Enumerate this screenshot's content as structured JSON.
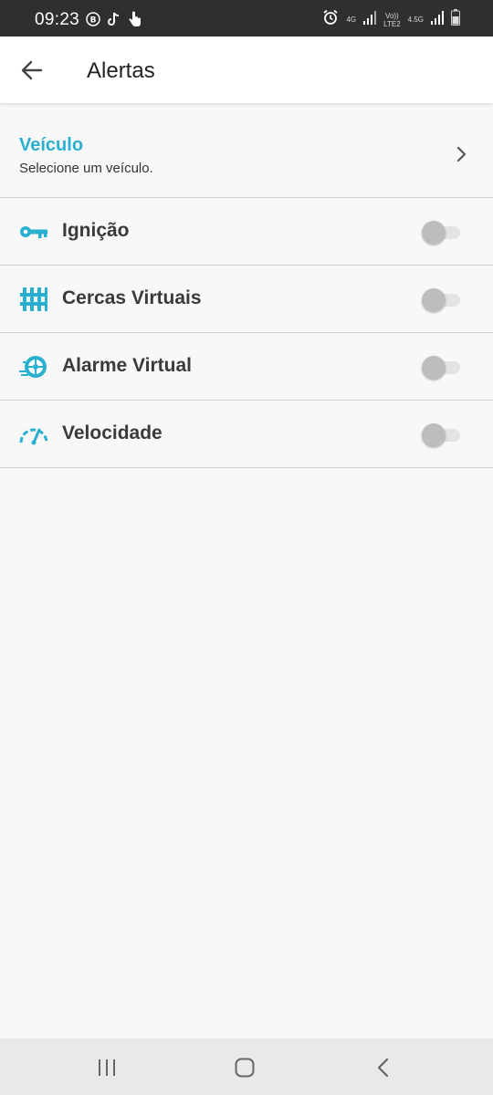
{
  "status_bar": {
    "time": "09:23",
    "left_icons": [
      "b-circle-icon",
      "tiktok-icon",
      "touch-hand-icon"
    ],
    "network_1": "4G",
    "network_2_top": "Vo))",
    "network_2_bottom": "LTE2",
    "network_3": "4.5G"
  },
  "app_bar": {
    "title": "Alertas",
    "back_icon": "arrow-left-icon"
  },
  "vehicle": {
    "title": "Veículo",
    "subtitle": "Selecione um veículo."
  },
  "alerts": [
    {
      "label": "Ignição",
      "icon": "key-icon",
      "enabled": false
    },
    {
      "label": "Cercas Virtuais",
      "icon": "fence-icon",
      "enabled": false
    },
    {
      "label": "Alarme Virtual",
      "icon": "wheel-alarm-icon",
      "enabled": false
    },
    {
      "label": "Velocidade",
      "icon": "speedometer-icon",
      "enabled": false
    }
  ],
  "nav_bar": [
    "recent-apps-icon",
    "home-icon",
    "back-icon"
  ],
  "colors": {
    "accent": "#29b0cf",
    "background": "#f8f8f8",
    "switch_thumb": "#bdbdbd"
  }
}
